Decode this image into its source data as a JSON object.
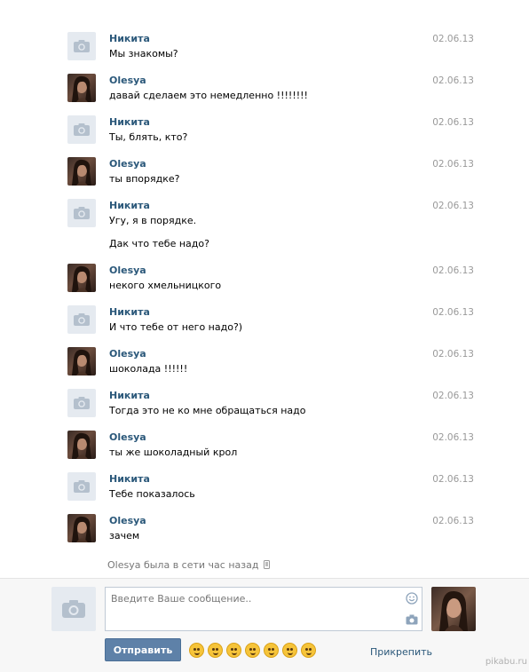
{
  "messages": [
    {
      "author": "Никита",
      "date": "02.06.13",
      "lines": [
        "Мы знакомы?"
      ],
      "avatar": "camera"
    },
    {
      "author": "Olesya",
      "date": "02.06.13",
      "lines": [
        "давай сделаем это немедленно !!!!!!!!"
      ],
      "avatar": "photo"
    },
    {
      "author": "Никита",
      "date": "02.06.13",
      "lines": [
        "Ты, блять, кто?"
      ],
      "avatar": "camera"
    },
    {
      "author": "Olesya",
      "date": "02.06.13",
      "lines": [
        "ты впорядке?"
      ],
      "avatar": "photo"
    },
    {
      "author": "Никита",
      "date": "02.06.13",
      "lines": [
        "Угу, я в порядке.",
        "Дак что тебе надо?"
      ],
      "avatar": "camera"
    },
    {
      "author": "Olesya",
      "date": "02.06.13",
      "lines": [
        "некого хмельницкого"
      ],
      "avatar": "photo"
    },
    {
      "author": "Никита",
      "date": "02.06.13",
      "lines": [
        "И что тебе от него надо?)"
      ],
      "avatar": "camera"
    },
    {
      "author": "Olesya",
      "date": "02.06.13",
      "lines": [
        "шоколада !!!!!!"
      ],
      "avatar": "photo"
    },
    {
      "author": "Никита",
      "date": "02.06.13",
      "lines": [
        "Тогда это не ко мне обращаться надо"
      ],
      "avatar": "camera"
    },
    {
      "author": "Olesya",
      "date": "02.06.13",
      "lines": [
        "ты же шоколадный крол"
      ],
      "avatar": "photo"
    },
    {
      "author": "Никита",
      "date": "02.06.13",
      "lines": [
        "Тебе показалось"
      ],
      "avatar": "camera"
    },
    {
      "author": "Olesya",
      "date": "02.06.13",
      "lines": [
        "зачем"
      ],
      "avatar": "photo"
    }
  ],
  "status": "Olesya была в сети час назад",
  "composer": {
    "placeholder": "Введите Ваше сообщение..",
    "send_label": "Отправить",
    "attach_label": "Прикрепить",
    "emojis": [
      "grin",
      "flushed",
      "crying",
      "pensive",
      "weary",
      "grin-teeth",
      "wink"
    ]
  },
  "watermark": "pikabu.ru",
  "colors": {
    "name": "#2b587a",
    "date": "#999999",
    "send": "#5e81a8"
  }
}
